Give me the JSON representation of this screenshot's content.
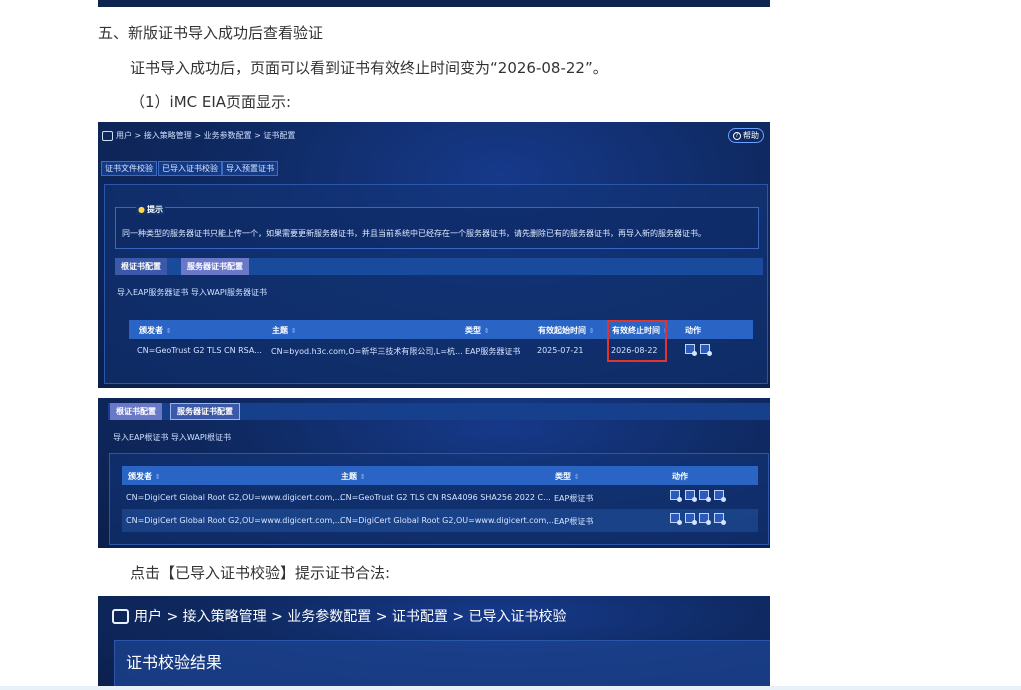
{
  "heading": "五、新版证书导入成功后查看验证",
  "para1": "证书导入成功后，页面可以看到证书有效终止时间变为“2026-08-22”。",
  "para2": "（1）iMC EIA页面显示:",
  "para3": "点击【已导入证书校验】提示证书合法:",
  "shot1": {
    "breadcrumb": "用户 > 接入策略管理 > 业务参数配置 > 证书配置",
    "help": "帮助",
    "tabs": [
      "证书文件校验",
      "已导入证书校验",
      "导入预置证书"
    ],
    "tip_title": "提示",
    "tip_text": "同一种类型的服务器证书只能上传一个，如果需要更新服务器证书，并且当前系统中已经存在一个服务器证书，请先删除已有的服务器证书，再导入新的服务器证书。",
    "subtabs": [
      "根证书配置",
      "服务器证书配置"
    ],
    "links": "导入EAP服务器证书  导入WAPI服务器证书",
    "columns": [
      "颁发者",
      "主题",
      "类型",
      "有效起始时间",
      "有效终止时间",
      "动作"
    ],
    "row": [
      "CN=GeoTrust G2 TLS CN RSA...",
      "CN=byod.h3c.com,O=新华三技术有限公司,L=杭...",
      "EAP服务器证书",
      "2025-07-21",
      "2026-08-22"
    ]
  },
  "shot2": {
    "subtabs": [
      "根证书配置",
      "服务器证书配置"
    ],
    "links": "导入EAP根证书  导入WAPI根证书",
    "columns": [
      "颁发者",
      "主题",
      "类型",
      "动作"
    ],
    "rows": [
      [
        "CN=DigiCert Global Root G2,OU=www.digicert.com,...",
        "CN=GeoTrust G2 TLS CN RSA4096 SHA256 2022 C...",
        "EAP根证书"
      ],
      [
        "CN=DigiCert Global Root G2,OU=www.digicert.com,...",
        "CN=DigiCert Global Root G2,OU=www.digicert.com,...",
        "EAP根证书"
      ]
    ]
  },
  "shot3": {
    "breadcrumb": "用户 > 接入策略管理 > 业务参数配置 > 证书配置 > 已导入证书校验",
    "panel_title": "证书校验结果"
  },
  "colors": {
    "highlight": "#e2332e",
    "header": "#2a64c4",
    "bg": "#0f2a63"
  },
  "icons": [
    "user-config-icon",
    "help-circle-icon",
    "lightbulb-icon",
    "cert-action-icon"
  ]
}
